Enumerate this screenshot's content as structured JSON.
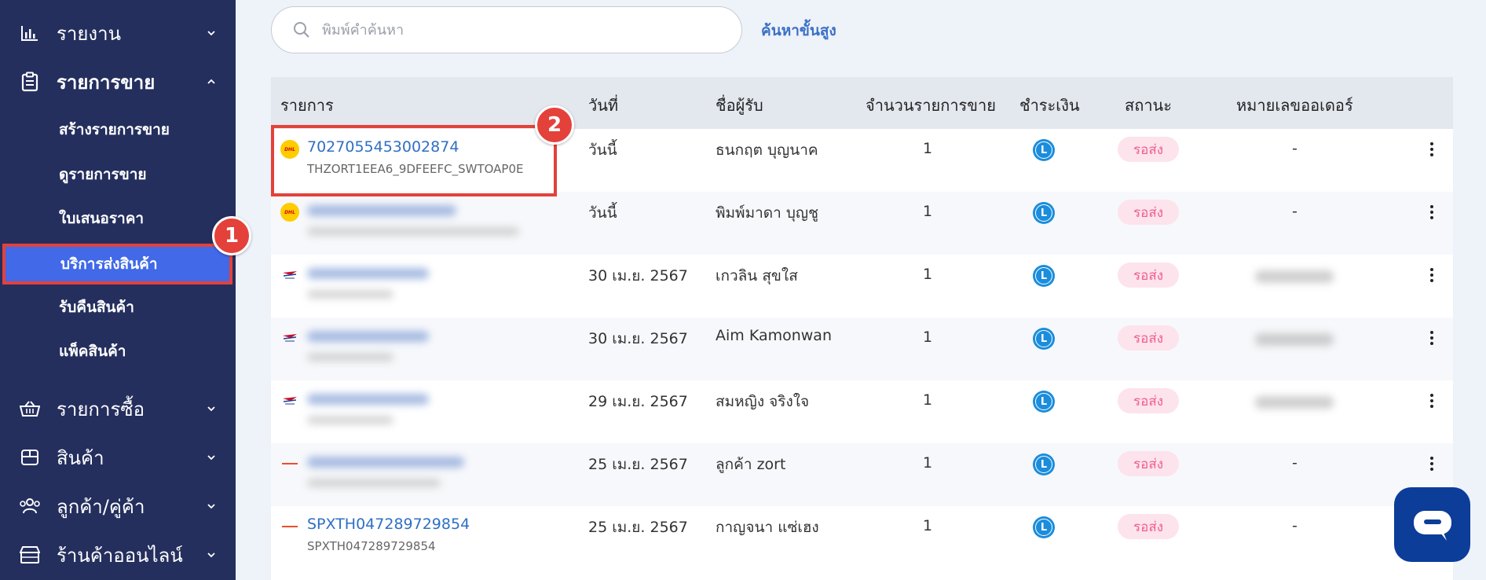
{
  "sidebar": {
    "items": [
      {
        "label": "รายงาน",
        "icon": "bar-chart-icon"
      },
      {
        "label": "รายการขาย",
        "icon": "clipboard-icon"
      },
      {
        "label": "รายการซื้อ",
        "icon": "basket-icon"
      },
      {
        "label": "สินค้า",
        "icon": "box-icon"
      },
      {
        "label": "ลูกค้า/คู่ค้า",
        "icon": "users-icon"
      },
      {
        "label": "ร้านค้าออนไลน์",
        "icon": "store-icon"
      }
    ],
    "sub_items": [
      {
        "label": "สร้างรายการขาย"
      },
      {
        "label": "ดูรายการขาย"
      },
      {
        "label": "ใบเสนอราคา"
      },
      {
        "label": "บริการส่งสินค้า",
        "active": true
      },
      {
        "label": "รับคืนสินค้า"
      },
      {
        "label": "แพ็คสินค้า"
      }
    ]
  },
  "search": {
    "placeholder": "พิมพ์คำค้นหา",
    "value": ""
  },
  "advanced_search": "ค้นหาขั้นสูง",
  "table": {
    "headers": [
      "รายการ",
      "วันที่",
      "ชื่อผู้รับ",
      "จำนวนรายการขาย",
      "ชำระเงิน",
      "สถานะ",
      "หมายเลขออเดอร์"
    ],
    "rows": [
      {
        "carrier": "dhl",
        "order_no": "7027055453002874",
        "sub": "THZORT1EEA6_9DFEEFC_SWTOAP0E",
        "date": "วันนี้",
        "recipient": "ธนกฤต บุญนาค",
        "qty": "1",
        "status": "รอส่ง",
        "order_id": "-"
      },
      {
        "carrier": "dhl",
        "order_no": "",
        "sub": "",
        "date": "วันนี้",
        "recipient": "พิมพ์มาดา บุญชู",
        "qty": "1",
        "status": "รอส่ง",
        "order_id": "-"
      },
      {
        "carrier": "thaipost",
        "order_no": "",
        "sub": "",
        "date": "30 เม.ย. 2567",
        "recipient": "เกวลิน สุขใส",
        "qty": "1",
        "status": "รอส่ง",
        "order_id": ""
      },
      {
        "carrier": "thaipost",
        "order_no": "",
        "sub": "",
        "date": "30 เม.ย. 2567",
        "recipient": "Aim Kamonwan",
        "qty": "1",
        "status": "รอส่ง",
        "order_id": ""
      },
      {
        "carrier": "thaipost",
        "order_no": "",
        "sub": "",
        "date": "29 เม.ย. 2567",
        "recipient": "สมหญิง จริงใจ",
        "qty": "1",
        "status": "รอส่ง",
        "order_id": ""
      },
      {
        "carrier": "spx",
        "order_no": "",
        "sub": "",
        "date": "25 เม.ย. 2567",
        "recipient": "ลูกค้า zort",
        "qty": "1",
        "status": "รอส่ง",
        "order_id": "-"
      },
      {
        "carrier": "spx",
        "order_no": "SPXTH047289729854",
        "sub": "SPXTH047289729854",
        "date": "25 เม.ย. 2567",
        "recipient": "กาญจนา แซ่เฮง",
        "qty": "1",
        "status": "รอส่ง",
        "order_id": "-"
      }
    ]
  },
  "payment_icon_letter": "L",
  "carrier_dhl_text": "DHL",
  "annotations": [
    "1",
    "2"
  ],
  "colors": {
    "sidebar_bg": "#242f5e",
    "active_bg": "#4169e8",
    "annotation_red": "#e4413b",
    "link_blue": "#2f6fc4",
    "status_pink": "#ef5f8e",
    "chat_bg": "#0b3d99"
  }
}
